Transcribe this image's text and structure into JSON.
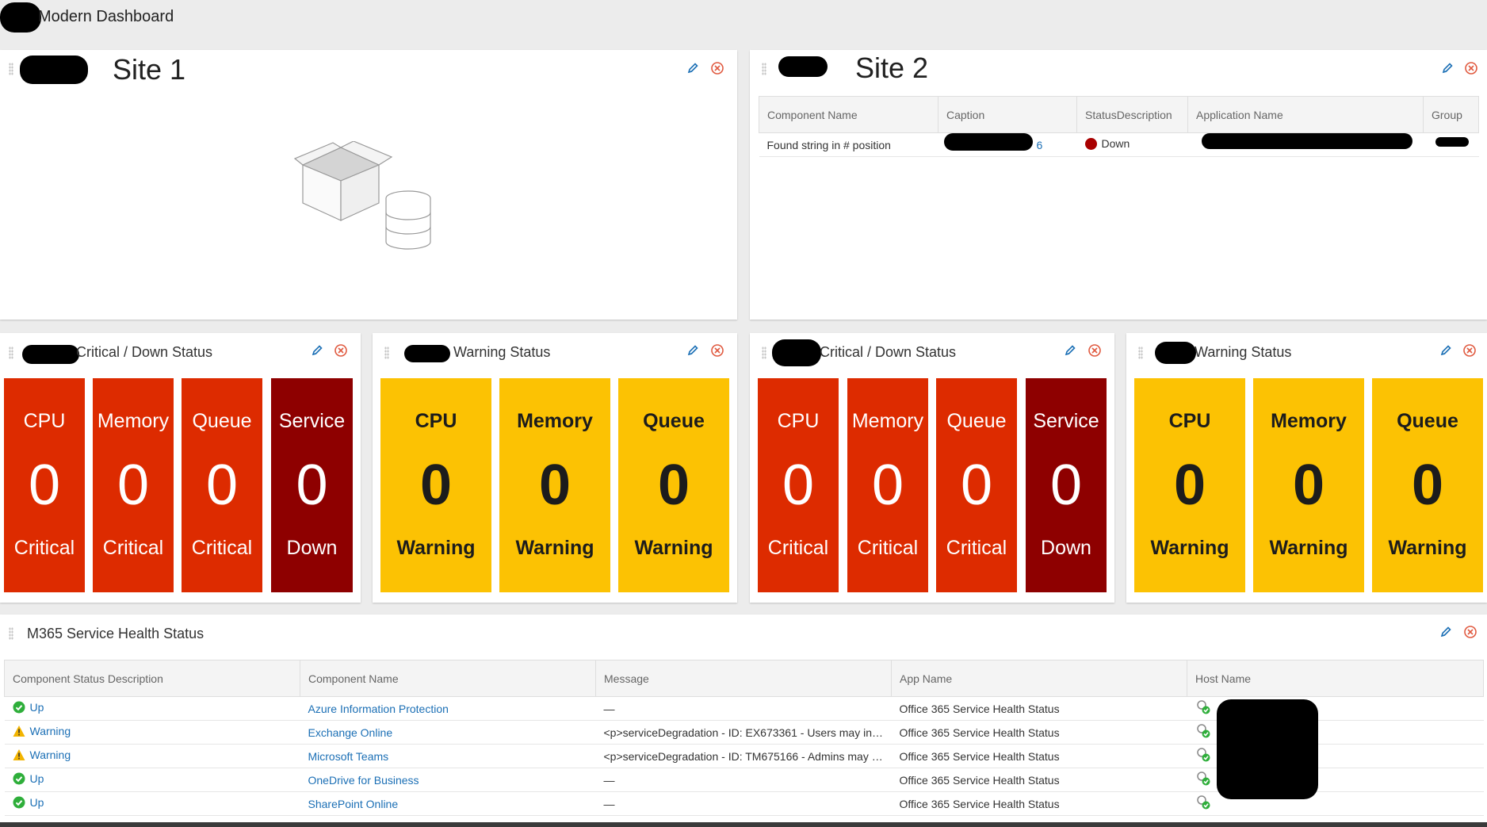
{
  "page": {
    "title": "Modern Dashboard"
  },
  "site1": {
    "title": "Site 1"
  },
  "site2": {
    "title": "Site 2",
    "columns": [
      "Component Name",
      "Caption",
      "StatusDescription",
      "Application Name",
      "Group"
    ],
    "row": {
      "component": "Found string in # position",
      "caption_tail": "6",
      "status": "Down"
    }
  },
  "statusPanels": [
    {
      "title": "Critical / Down Status",
      "tiles": [
        {
          "label": "CPU",
          "value": "0",
          "status": "Critical"
        },
        {
          "label": "Memory",
          "value": "0",
          "status": "Critical"
        },
        {
          "label": "Queue",
          "value": "0",
          "status": "Critical"
        },
        {
          "label": "Service",
          "value": "0",
          "status": "Down"
        }
      ]
    },
    {
      "title": "Warning Status",
      "tiles": [
        {
          "label": "CPU",
          "value": "0",
          "status": "Warning"
        },
        {
          "label": "Memory",
          "value": "0",
          "status": "Warning"
        },
        {
          "label": "Queue",
          "value": "0",
          "status": "Warning"
        }
      ]
    },
    {
      "title": "Critical / Down Status",
      "tiles": [
        {
          "label": "CPU",
          "value": "0",
          "status": "Critical"
        },
        {
          "label": "Memory",
          "value": "0",
          "status": "Critical"
        },
        {
          "label": "Queue",
          "value": "0",
          "status": "Critical"
        },
        {
          "label": "Service",
          "value": "0",
          "status": "Down"
        }
      ]
    },
    {
      "title": "Warning Status",
      "tiles": [
        {
          "label": "CPU",
          "value": "0",
          "status": "Warning"
        },
        {
          "label": "Memory",
          "value": "0",
          "status": "Warning"
        },
        {
          "label": "Queue",
          "value": "0",
          "status": "Warning"
        }
      ]
    }
  ],
  "m365": {
    "title": "M365 Service Health Status",
    "columns": [
      "Component Status Description",
      "Component Name",
      "Message",
      "App Name",
      "Host Name"
    ],
    "rows": [
      {
        "status": "Up",
        "icon": "check-circle-icon",
        "component": "Azure Information Protection",
        "message": "—",
        "app": "Office 365 Service Health Status"
      },
      {
        "status": "Warning",
        "icon": "warning-triangle-icon",
        "component": "Exchange Online",
        "message": "<p>serviceDegradation - ID: EX673361 - Users may inter…",
        "app": "Office 365 Service Health Status"
      },
      {
        "status": "Warning",
        "icon": "warning-triangle-icon",
        "component": "Microsoft Teams",
        "message": "<p>serviceDegradation - ID: TM675166 - Admins may b…",
        "app": "Office 365 Service Health Status"
      },
      {
        "status": "Up",
        "icon": "check-circle-icon",
        "component": "OneDrive for Business",
        "message": "—",
        "app": "Office 365 Service Health Status"
      },
      {
        "status": "Up",
        "icon": "check-circle-icon",
        "component": "SharePoint Online",
        "message": "—",
        "app": "Office 365 Service Health Status"
      }
    ]
  },
  "colors": {
    "critical": "#dd2b00",
    "down": "#8e0000",
    "warning": "#fcc203",
    "up": "#2eae3a",
    "link": "#1b6fb5"
  },
  "icons": {
    "edit": "pencil-icon",
    "remove": "close-circle-icon",
    "drag": "drag-handle-icon",
    "empty": "empty-box-database-icon"
  }
}
